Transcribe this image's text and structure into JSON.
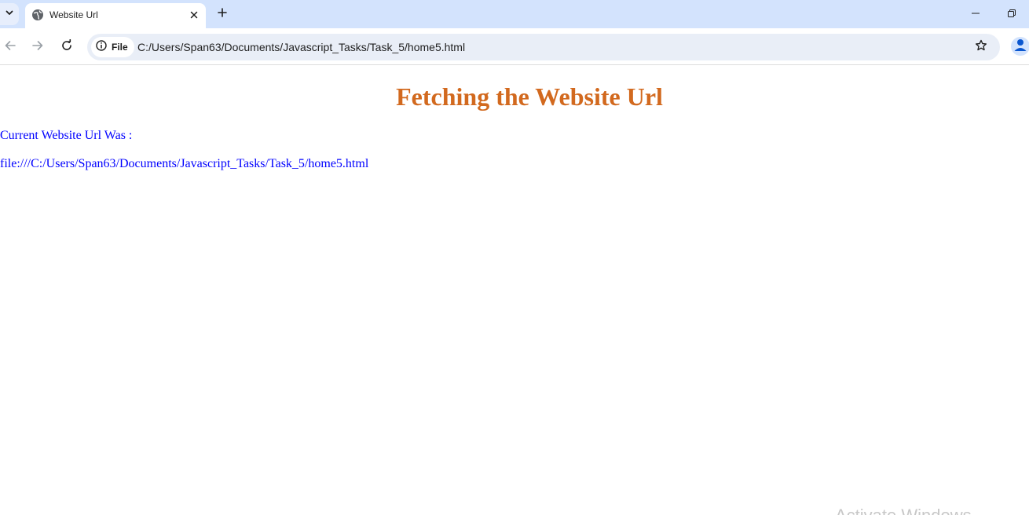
{
  "browser": {
    "tab": {
      "title": "Website Url",
      "favicon": "globe-icon"
    },
    "omnibox": {
      "chip_label": "File",
      "url": "C:/Users/Span63/Documents/Javascript_Tasks/Task_5/home5.html"
    },
    "accent_color": "#d3e3fd"
  },
  "page": {
    "heading": "Fetching the Website Url",
    "heading_color": "#d2691e",
    "label": "Current Website Url Was :",
    "url_value": "file:///C:/Users/Span63/Documents/Javascript_Tasks/Task_5/home5.html",
    "text_color": "#0000ff"
  },
  "watermark": {
    "text": "Activate Windows"
  }
}
